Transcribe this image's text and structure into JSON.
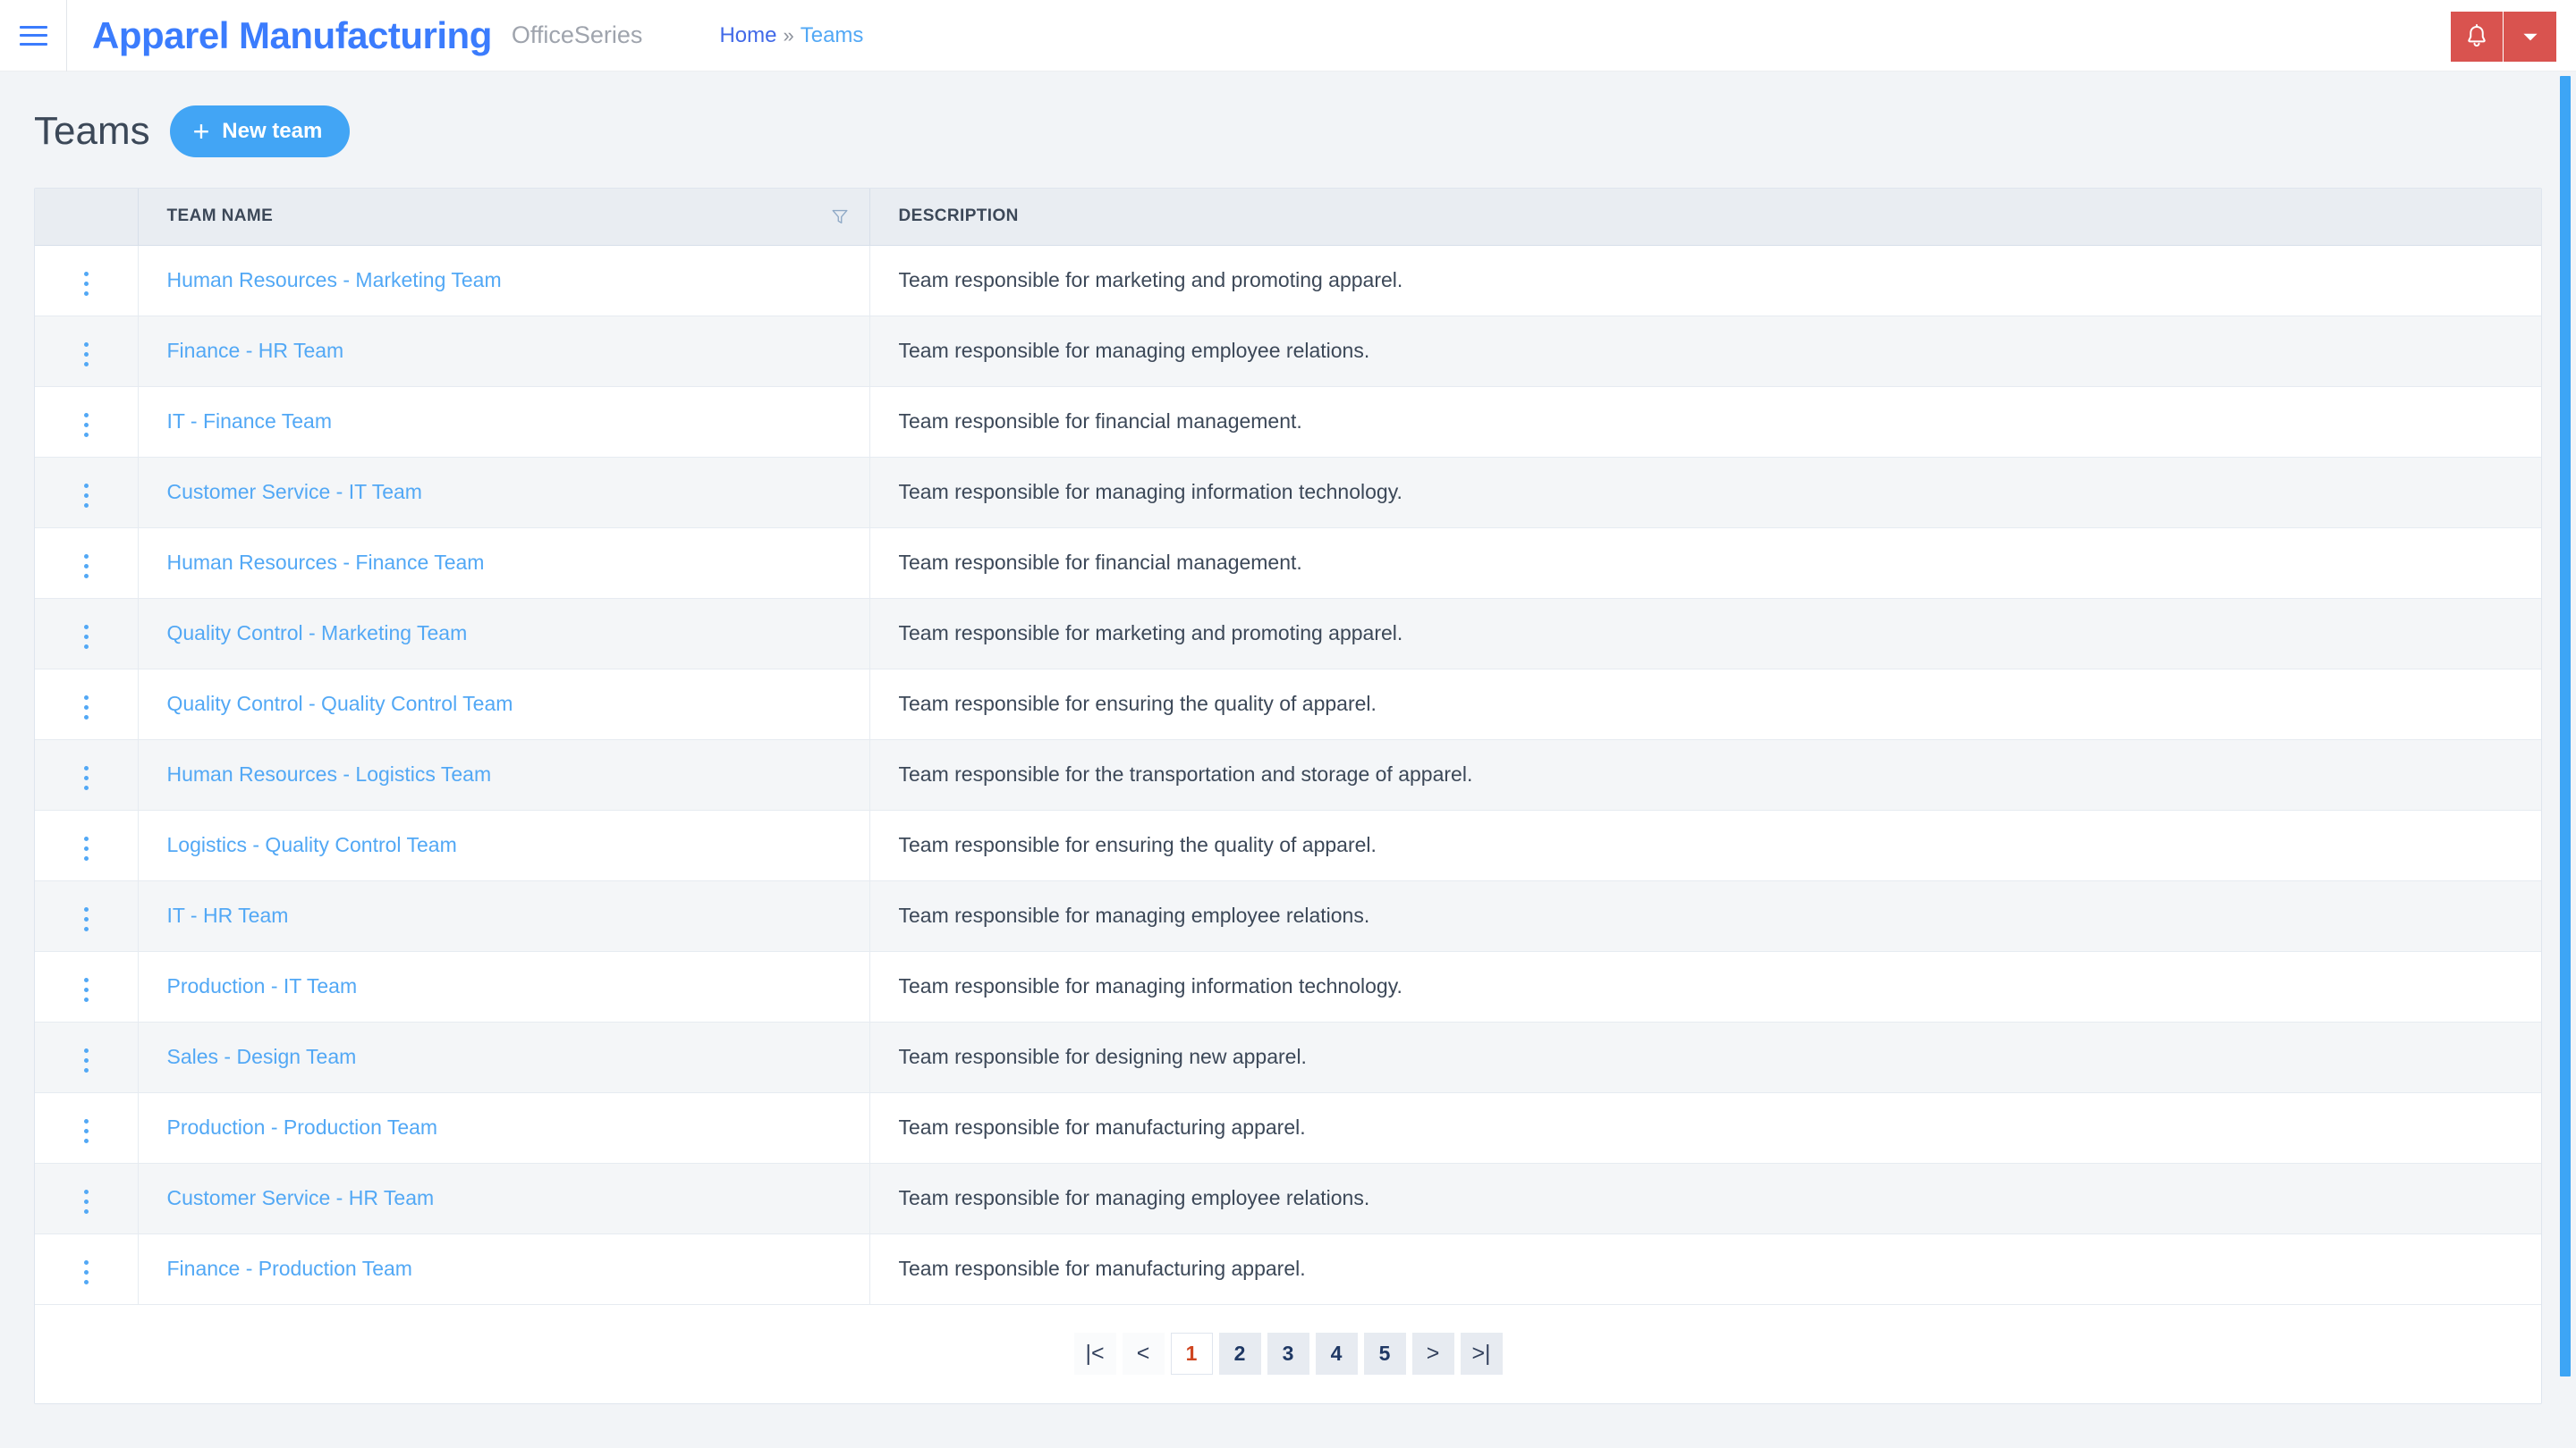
{
  "navbar": {
    "menu_icon": "hamburger-icon",
    "brand": "Apparel Manufacturing",
    "brand_sub": "OfficeSeries",
    "breadcrumb": {
      "home": "Home",
      "separator": "»",
      "current": "Teams"
    },
    "notification_icon": "bell-icon",
    "dropdown_icon": "chevron-down-icon",
    "accent_red": "#d9534f",
    "accent_blue": "#3b7cfd"
  },
  "page": {
    "title": "Teams",
    "new_team_label": "New team",
    "new_team_icon": "plus-icon",
    "accent_button": "#42a5f5"
  },
  "table": {
    "columns": {
      "menu": "",
      "name": "TEAM NAME",
      "description": "DESCRIPTION"
    },
    "filter_icon": "filter-icon",
    "row_menu_icon": "kebab-menu-icon",
    "rows": [
      {
        "name": "Human Resources - Marketing Team",
        "description": "Team responsible for marketing and promoting apparel."
      },
      {
        "name": "Finance - HR Team",
        "description": "Team responsible for managing employee relations."
      },
      {
        "name": "IT - Finance Team",
        "description": "Team responsible for financial management."
      },
      {
        "name": "Customer Service - IT Team",
        "description": "Team responsible for managing information technology."
      },
      {
        "name": "Human Resources - Finance Team",
        "description": "Team responsible for financial management."
      },
      {
        "name": "Quality Control - Marketing Team",
        "description": "Team responsible for marketing and promoting apparel."
      },
      {
        "name": "Quality Control - Quality Control Team",
        "description": "Team responsible for ensuring the quality of apparel."
      },
      {
        "name": "Human Resources - Logistics Team",
        "description": "Team responsible for the transportation and storage of apparel."
      },
      {
        "name": "Logistics - Quality Control Team",
        "description": "Team responsible for ensuring the quality of apparel."
      },
      {
        "name": "IT - HR Team",
        "description": "Team responsible for managing employee relations."
      },
      {
        "name": "Production - IT Team",
        "description": "Team responsible for managing information technology."
      },
      {
        "name": "Sales - Design Team",
        "description": "Team responsible for designing new apparel."
      },
      {
        "name": "Production - Production Team",
        "description": "Team responsible for manufacturing apparel."
      },
      {
        "name": "Customer Service - HR Team",
        "description": "Team responsible for managing employee relations."
      },
      {
        "name": "Finance - Production Team",
        "description": "Team responsible for manufacturing apparel."
      }
    ]
  },
  "pagination": {
    "first_label": "|<",
    "prev_label": "<",
    "next_label": ">",
    "last_label": ">|",
    "pages": [
      "1",
      "2",
      "3",
      "4",
      "5"
    ],
    "active_page": "1",
    "active_color": "#cf4520"
  }
}
